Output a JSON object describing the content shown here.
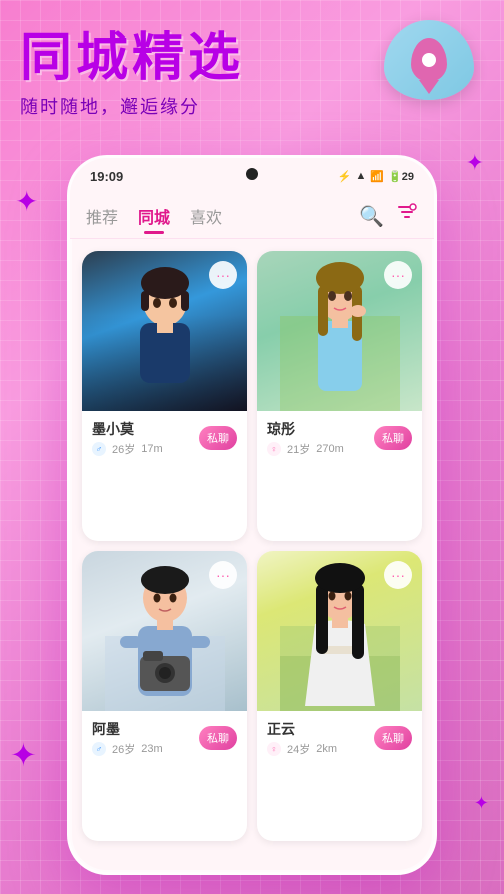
{
  "app": {
    "title": "同城精选",
    "subtitle": "随时随地，邂逅缘分"
  },
  "status_bar": {
    "time": "19:09",
    "icons": "⚡ ▲ ☰ 📶 🔋"
  },
  "nav": {
    "tabs": [
      {
        "label": "推荐",
        "active": false
      },
      {
        "label": "同城",
        "active": true
      },
      {
        "label": "喜欢",
        "active": false
      }
    ],
    "search_icon": "🔍",
    "filter_icon": "filter"
  },
  "users": [
    {
      "name": "墨小莫",
      "gender": "male",
      "age": "26岁",
      "distance": "17m",
      "chat_label": "私聊",
      "photo_color_top": "#2c3e50",
      "photo_color_bottom": "#3a5f8a"
    },
    {
      "name": "琼彤",
      "gender": "female",
      "age": "21岁",
      "distance": "270m",
      "chat_label": "私聊",
      "photo_color_top": "#7db87d",
      "photo_color_bottom": "#a8d8a8"
    },
    {
      "name": "阿墨",
      "gender": "male",
      "age": "26岁",
      "distance": "23m",
      "chat_label": "私聊",
      "photo_color_top": "#b0c4de",
      "photo_color_bottom": "#d0dff0"
    },
    {
      "name": "正云",
      "gender": "female",
      "age": "24岁",
      "distance": "2km",
      "chat_label": "私聊",
      "photo_color_top": "#90c090",
      "photo_color_bottom": "#c8e8c8"
    }
  ],
  "sparkles": [
    "✦",
    "✦",
    "✦",
    "✦"
  ]
}
